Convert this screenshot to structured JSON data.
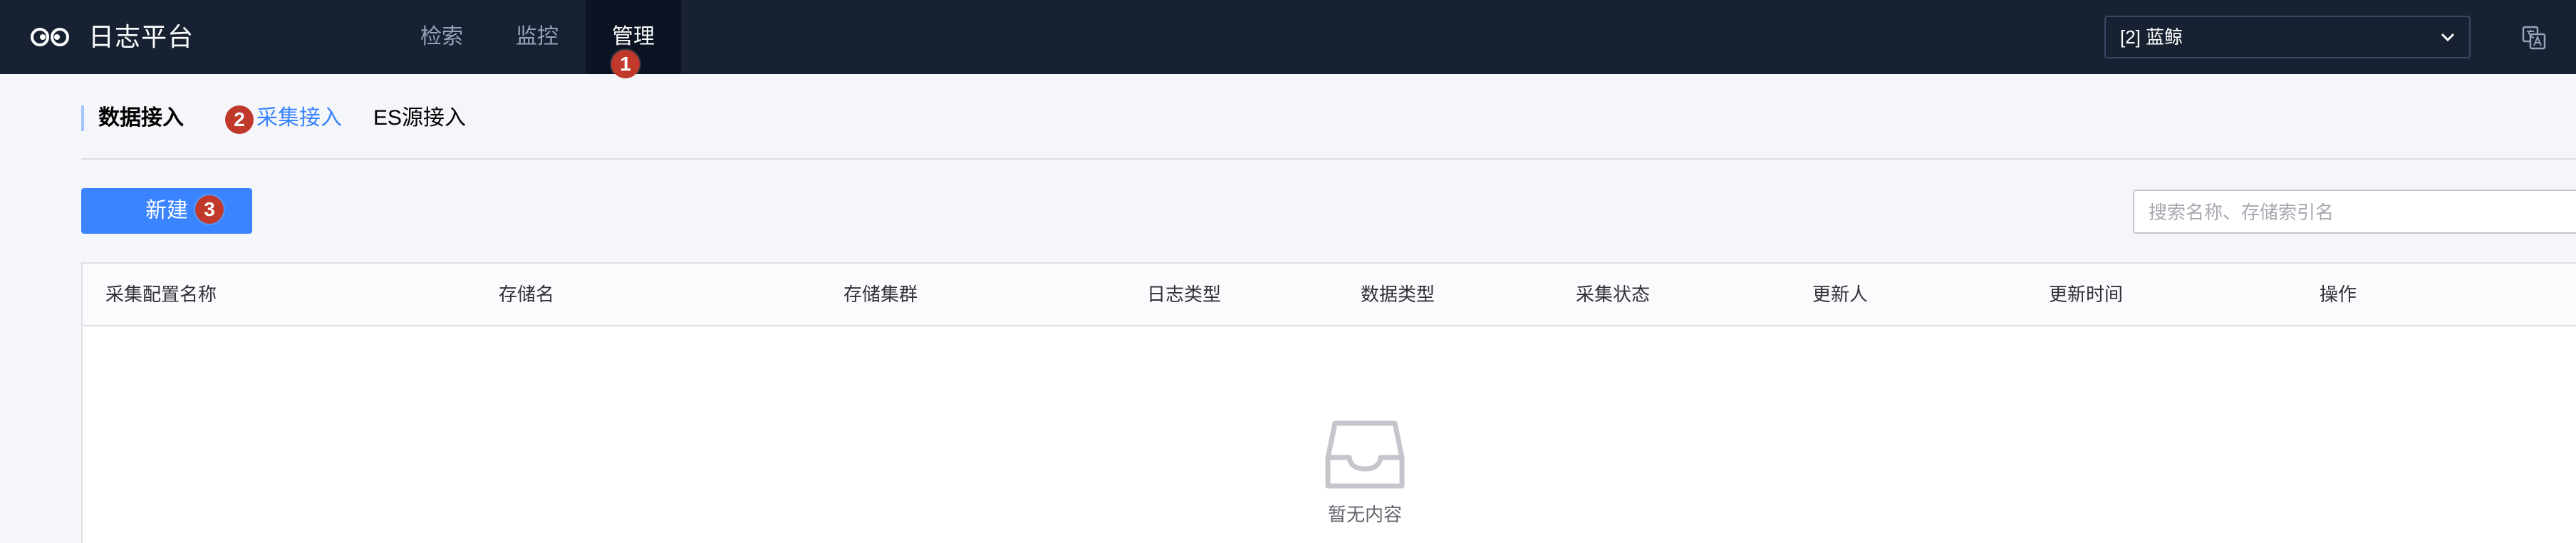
{
  "app": {
    "title": "日志平台"
  },
  "nav": {
    "items": [
      {
        "label": "检索",
        "active": false
      },
      {
        "label": "监控",
        "active": false
      },
      {
        "label": "管理",
        "active": true,
        "badge": "1"
      }
    ]
  },
  "business_select": {
    "value": "[2] 蓝鲸"
  },
  "subnav": {
    "title": "数据接入",
    "tabs": [
      {
        "label": "采集接入",
        "active": true,
        "badge": "2"
      },
      {
        "label": "ES源接入",
        "active": false
      }
    ]
  },
  "toolbar": {
    "new_label": "新建",
    "new_badge": "3",
    "search_placeholder": "搜索名称、存储索引名"
  },
  "table": {
    "columns": [
      "采集配置名称",
      "存储名",
      "存储集群",
      "日志类型",
      "数据类型",
      "采集状态",
      "更新人",
      "更新时间",
      "操作"
    ],
    "rows": [],
    "empty_text": "暂无内容"
  },
  "colors": {
    "topbar_bg": "#182132",
    "accent": "#3a84ff",
    "badge": "#c0392b"
  }
}
